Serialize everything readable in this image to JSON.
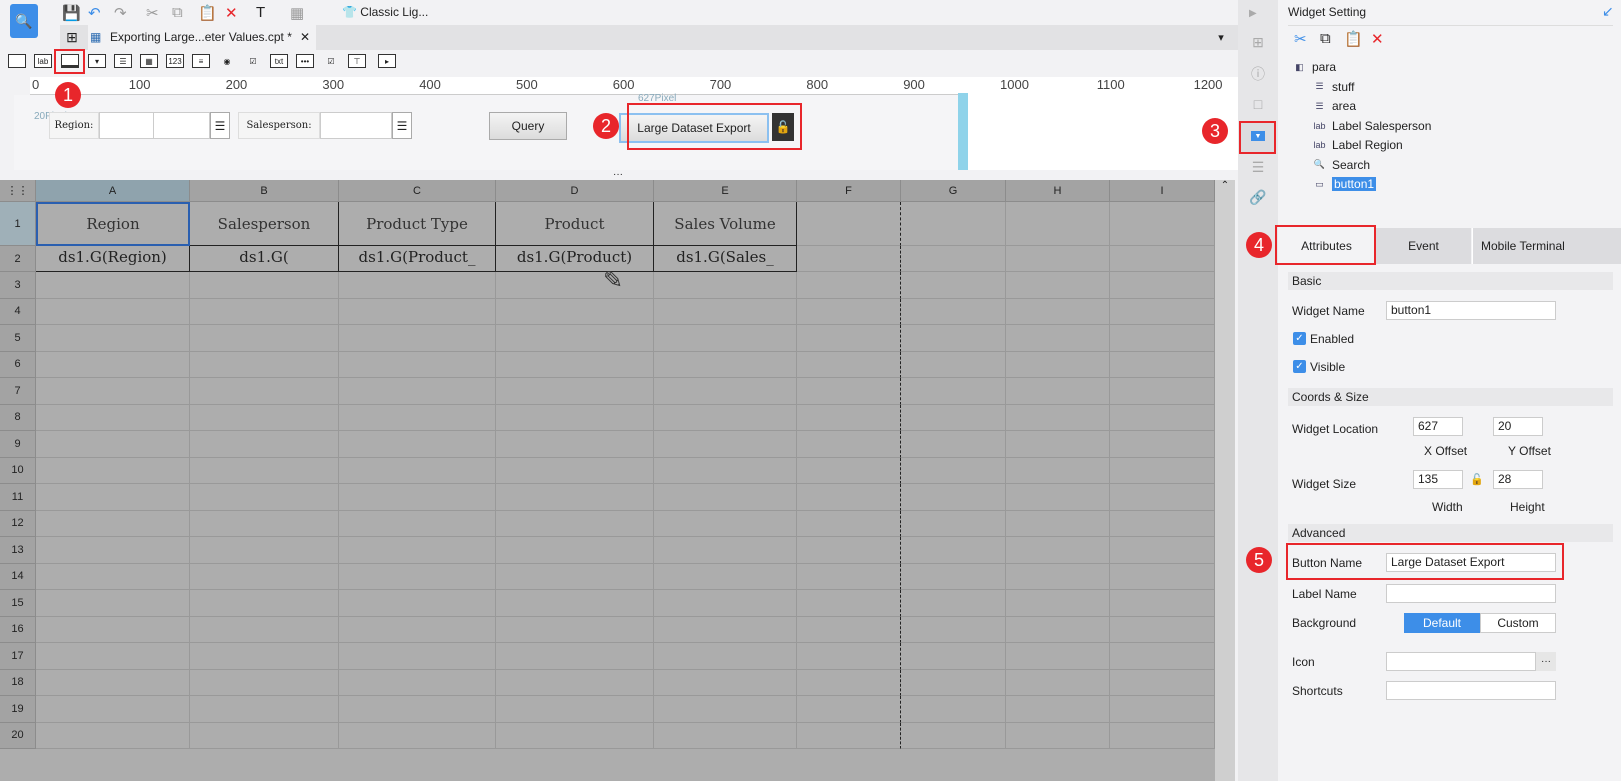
{
  "toolbar": {
    "style_label": "Classic Lig..."
  },
  "tab": {
    "title": "Exporting Large...eter Values.cpt *"
  },
  "ruler": {
    "ticks": [
      "0",
      "100",
      "200",
      "300",
      "400",
      "500",
      "600",
      "700",
      "800",
      "900",
      "1000",
      "1100",
      "1200"
    ],
    "left_tick": "0"
  },
  "param": {
    "y_hint": "20Pixel",
    "x_hint": "627Pixel",
    "label_region": "Region:",
    "label_salesperson": "Salesperson:",
    "query": "Query",
    "export_button": "Large Dataset Export"
  },
  "grid": {
    "columns": [
      "A",
      "B",
      "C",
      "D",
      "E",
      "F",
      "G",
      "H",
      "I"
    ],
    "row_numbers": [
      "1",
      "2",
      "3",
      "4",
      "5",
      "6",
      "7",
      "8",
      "9",
      "10",
      "11",
      "12",
      "13",
      "14",
      "15",
      "16",
      "17",
      "18",
      "19",
      "20"
    ],
    "headers": [
      "Region",
      "Salesperson",
      "Product Type",
      "Product",
      "Sales Volume"
    ],
    "formulas": [
      "ds1.G(Region)",
      "ds1.G(",
      "ds1.G(Product_",
      "ds1.G(Product)",
      "ds1.G(Sales_"
    ]
  },
  "badges": [
    "1",
    "2",
    "3",
    "4",
    "5"
  ],
  "panel": {
    "title": "Widget Setting",
    "tree": [
      {
        "label": "para",
        "icon": "para-icon"
      },
      {
        "label": "stuff",
        "icon": "combo-icon"
      },
      {
        "label": "area",
        "icon": "combo-icon"
      },
      {
        "label": "Label Salesperson",
        "icon": "label-icon"
      },
      {
        "label": "Label Region",
        "icon": "label-icon"
      },
      {
        "label": "Search",
        "icon": "search-icon"
      },
      {
        "label": "button1",
        "icon": "button-icon"
      }
    ],
    "tabs": [
      "Attributes",
      "Event",
      "Mobile Terminal"
    ],
    "basic": "Basic",
    "widget_name_label": "Widget Name",
    "widget_name": "button1",
    "enabled": "Enabled",
    "visible": "Visible",
    "coords": "Coords & Size",
    "location_label": "Widget Location",
    "x": "627",
    "y": "20",
    "x_label": "X Offset",
    "y_label": "Y Offset",
    "size_label": "Widget Size",
    "width": "135",
    "height": "28",
    "width_label": "Width",
    "height_label": "Height",
    "advanced": "Advanced",
    "button_name_label": "Button Name",
    "button_name": "Large Dataset Export",
    "label_name_label": "Label Name",
    "label_name": "",
    "background_label": "Background",
    "bg_default": "Default",
    "bg_custom": "Custom",
    "icon_label": "Icon",
    "icon_btn": "···",
    "shortcuts_label": "Shortcuts",
    "shortcuts": ""
  },
  "colors": {
    "accent": "#3d8ee8",
    "badge": "#e8262b"
  }
}
